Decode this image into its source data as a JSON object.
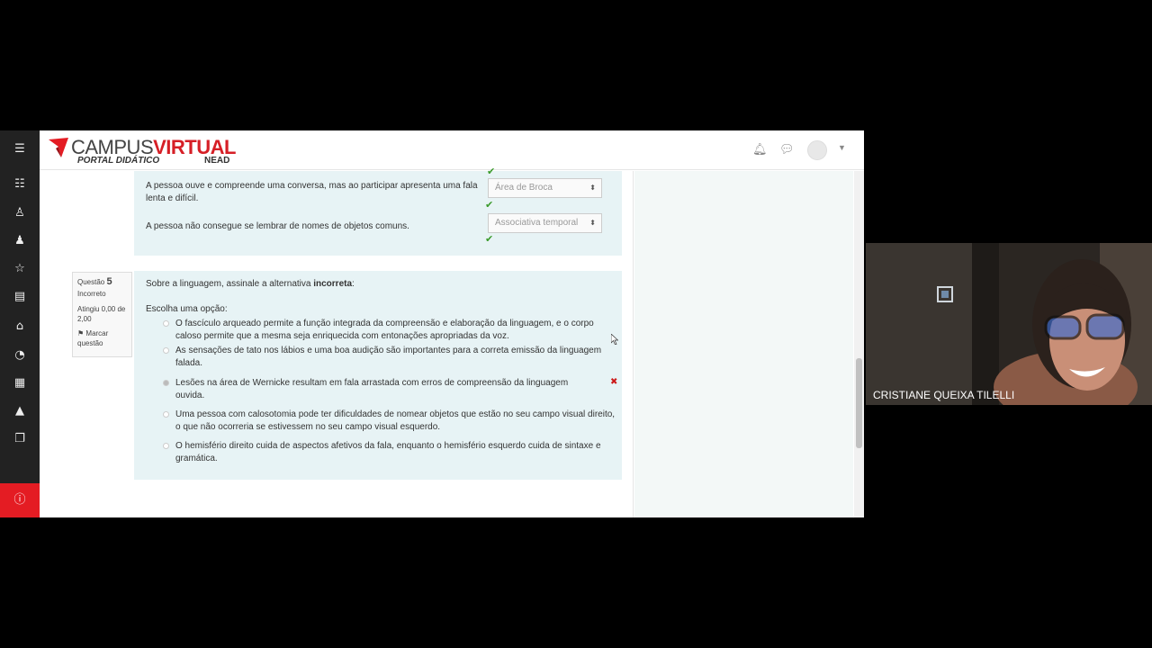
{
  "brand": {
    "campus": "CAMPUS",
    "virtual": "VIRTUAL",
    "portal": "PORTAL DIDÁTICO",
    "nead": "NEAD",
    "accent": "#e41c23"
  },
  "sidebar": {
    "icons": [
      "list-icon",
      "user-search-icon",
      "users-icon",
      "star-icon",
      "book-icon",
      "home-icon",
      "dashboard-icon",
      "calendar-icon",
      "graduation-cap-icon",
      "documents-icon",
      "info-icon"
    ]
  },
  "prev_question": {
    "items": [
      {
        "text": "A pessoa ouve e compreende uma conversa, mas ao participar apresenta uma fala lenta e difícil.",
        "answer": "Área de Broca"
      },
      {
        "text": "A pessoa não consegue se lembrar de nomes de objetos comuns.",
        "answer": "Associativa temporal"
      }
    ]
  },
  "question": {
    "label": "Questão",
    "number": "5",
    "state": "Incorreto",
    "grade": "Atingiu 0,00 de 2,00",
    "flag": "Marcar questão",
    "prompt": "Sobre a linguagem, assinale a alternativa",
    "prompt_bold": "incorreta",
    "prompt_end": ":",
    "choose": "Escolha uma opção:",
    "options": [
      "O fascículo arqueado permite a função integrada da compreensão e elaboração da linguagem, e o corpo caloso permite que a mesma seja enriquecida com entonações apropriadas da voz.",
      "As sensações de tato nos lábios e uma boa audição são importantes para a correta emissão da linguagem falada.",
      "Lesões na área de Wernicke resultam em fala arrastada com erros de compreensão da linguagem ouvida.",
      "Uma pessoa com calosotomia pode ter dificuldades de nomear objetos que estão no seu campo visual direito, o que não ocorreria se estivessem no seu campo visual esquerdo.",
      "O hemisfério direito cuida de aspectos afetivos da fala, enquanto o hemisfério esquerdo cuida de sintaxe e gramática."
    ],
    "selected_index": 2
  },
  "participant": {
    "name": "CRISTIANE QUEIXA TILELLI"
  }
}
